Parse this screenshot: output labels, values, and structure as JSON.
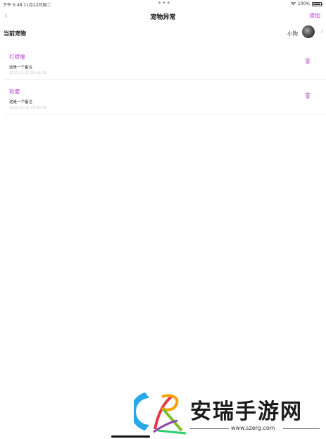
{
  "status_bar": {
    "time": "下午 5:48   11月22日周二",
    "dots": "•••",
    "battery": "100%"
  },
  "nav": {
    "title": "宠物异常",
    "add_label": "添加"
  },
  "pet": {
    "label": "当前宠物",
    "name": "小狗"
  },
  "records": [
    {
      "title": "打喷嚏",
      "note": "这是一个备注",
      "timestamp": "2022-11-22 05:46:25"
    },
    {
      "title": "软便",
      "note": "这是一个备注",
      "timestamp": "2022-11-22 05:46:38"
    }
  ],
  "watermark": {
    "text": "安瑞手游网",
    "url": "www.szerg.com"
  },
  "colors": {
    "accent": "#b23cd1",
    "timestamp": "#c8c8c8"
  }
}
